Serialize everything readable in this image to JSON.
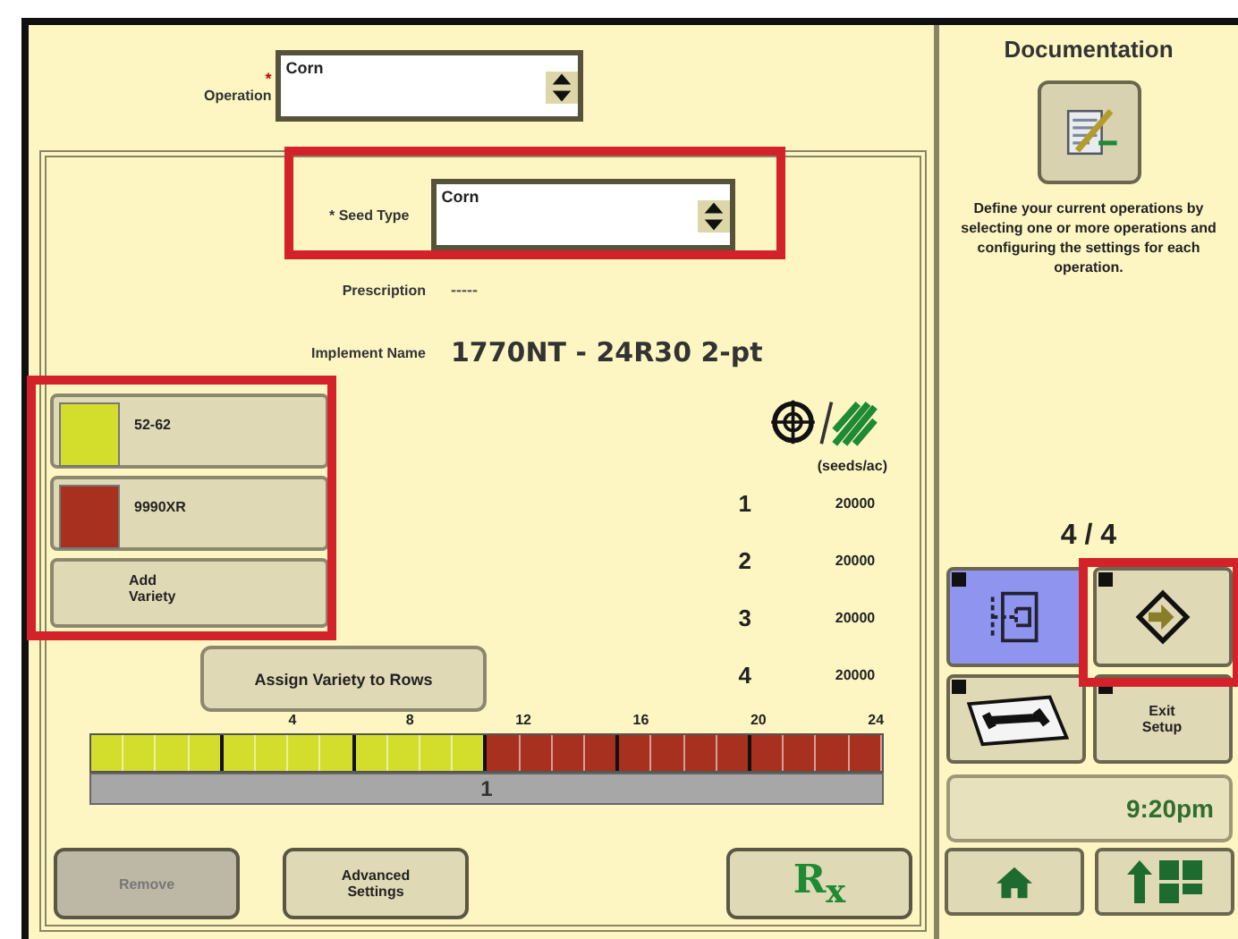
{
  "operation": {
    "label": "Operation",
    "required_mark": "*",
    "value": "Corn"
  },
  "seed_type": {
    "label": "* Seed Type",
    "value": "Corn"
  },
  "prescription": {
    "label": "Prescription",
    "value": "-----"
  },
  "implement": {
    "label": "Implement Name",
    "value": "1770NT - 24R30 2-pt"
  },
  "varieties": [
    {
      "name": "52-62",
      "color": "#d3de2c",
      "kind": "variety"
    },
    {
      "name": "9990XR",
      "color": "#a8301f",
      "kind": "variety"
    },
    {
      "name": "Add\nVariety",
      "kind": "add"
    }
  ],
  "assign_button": "Assign Variety to Rows",
  "rates": {
    "unit": "(seeds/ac)",
    "rows": [
      {
        "number": "1",
        "rate": "20000"
      },
      {
        "number": "2",
        "rate": "20000"
      },
      {
        "number": "3",
        "rate": "20000"
      },
      {
        "number": "4",
        "rate": "20000"
      }
    ]
  },
  "row_bar": {
    "ticks": [
      "4",
      "8",
      "12",
      "16",
      "20",
      "24"
    ],
    "section": "1",
    "rows": [
      {
        "color": "#d3de2c"
      },
      {
        "color": "#d3de2c"
      },
      {
        "color": "#d3de2c"
      },
      {
        "color": "#d3de2c"
      },
      {
        "color": "#d3de2c"
      },
      {
        "color": "#d3de2c"
      },
      {
        "color": "#d3de2c"
      },
      {
        "color": "#d3de2c"
      },
      {
        "color": "#d3de2c"
      },
      {
        "color": "#d3de2c"
      },
      {
        "color": "#d3de2c"
      },
      {
        "color": "#d3de2c"
      },
      {
        "color": "#a8301f"
      },
      {
        "color": "#a8301f"
      },
      {
        "color": "#a8301f"
      },
      {
        "color": "#a8301f"
      },
      {
        "color": "#a8301f"
      },
      {
        "color": "#a8301f"
      },
      {
        "color": "#a8301f"
      },
      {
        "color": "#a8301f"
      },
      {
        "color": "#a8301f"
      },
      {
        "color": "#a8301f"
      },
      {
        "color": "#a8301f"
      },
      {
        "color": "#a8301f"
      }
    ]
  },
  "bottom_buttons": [
    {
      "kind": "remove",
      "label": "Remove",
      "disabled": true
    },
    {
      "kind": "advanced",
      "label": "Advanced\nSettings",
      "disabled": false
    },
    {
      "kind": "rx",
      "label": "R$_{x}$",
      "disabled": false
    }
  ],
  "side": {
    "title": "Documentation",
    "description": "Define your current operations by selecting one or more operations and configuring the settings for each operation.",
    "page": "4 / 4",
    "grid_buttons": [
      {
        "kind": "layout",
        "selected": true
      },
      {
        "kind": "next",
        "selected": false
      },
      {
        "kind": "tools",
        "selected": false
      },
      {
        "kind": "exit",
        "label": "Exit\nSetup",
        "selected": false
      }
    ],
    "time": "9:20pm"
  }
}
